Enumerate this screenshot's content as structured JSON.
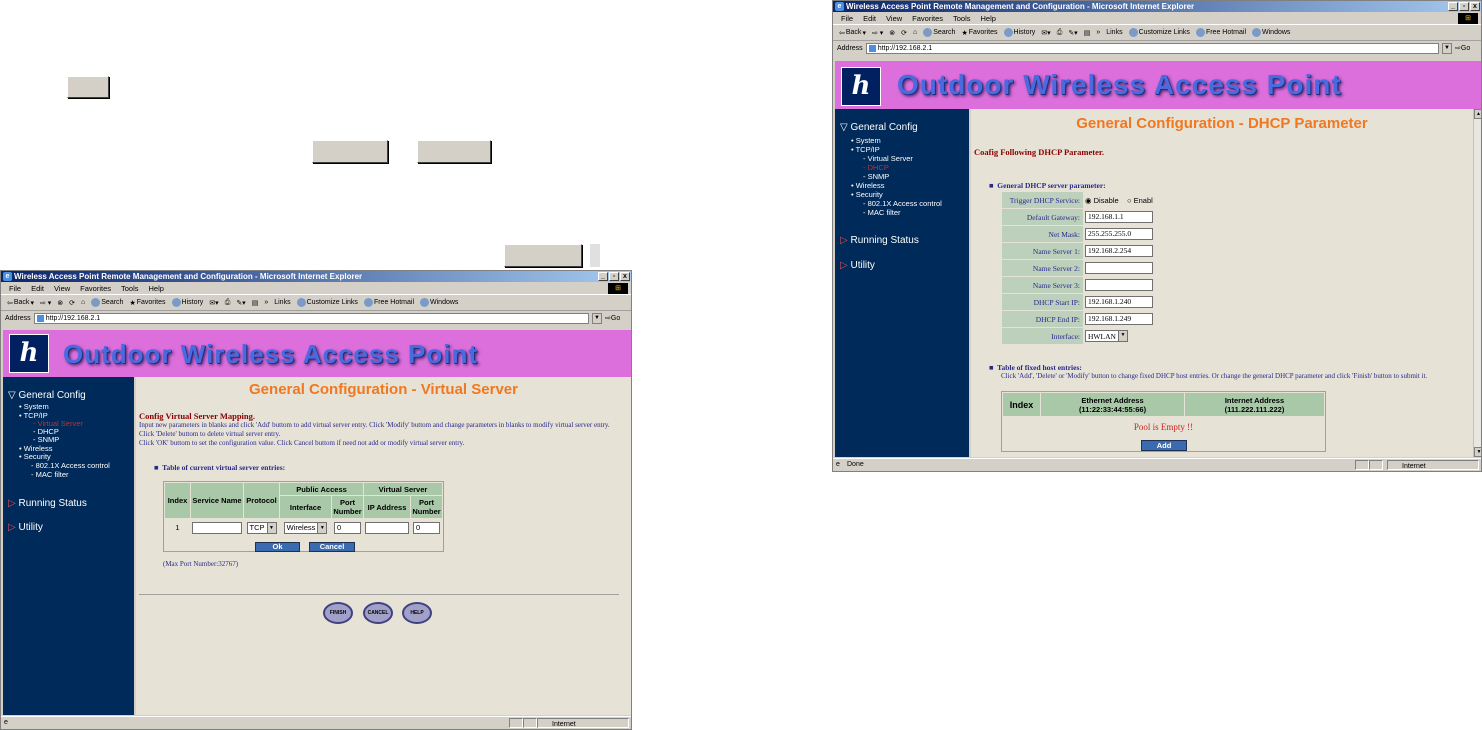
{
  "loose_buttons": {
    "a": "",
    "b": "",
    "c": "",
    "d": ""
  },
  "left_window": {
    "title": "Wireless Access Point Remote Management and Configuration - Microsoft Internet Explorer",
    "menu": [
      "File",
      "Edit",
      "View",
      "Favorites",
      "Tools",
      "Help"
    ],
    "toolbar": {
      "back": "Back",
      "search": "Search",
      "favorites": "Favorites",
      "history": "History",
      "links": "Links",
      "customize": "Customize Links",
      "hotmail": "Free Hotmail",
      "windows": "Windows"
    },
    "address_label": "Address",
    "address": "http://192.168.2.1",
    "go": "Go",
    "banner_title": "Outdoor Wireless Access Point",
    "sidebar": {
      "general": "General Config",
      "system": "System",
      "tcpip": "TCP/IP",
      "current": "Virtual Server",
      "dhcp": "DHCP",
      "snmp": "SNMP",
      "wireless": "Wireless",
      "security": "Security",
      "dot1x": "802.1X Access control",
      "mac": "MAC filter",
      "running": "Running Status",
      "utility": "Utility"
    },
    "page_title": "General Configuration - Virtual Server",
    "heading": "Config Virtual Server Mapping.",
    "instructions": "Input new parameters in blanks and click 'Add' buttom to add virtual server entry. Click 'Modify' buttom and change parameters in blanks to modify virtual server entry. Click 'Delete' buttom to delete virtual server entry.",
    "instructions2": "Click 'OK' buttom to set the configuration value. Click Cancel buttom if need not add or modify virtual server entry.",
    "table_caption": "Table of current virtual server entries:",
    "table": {
      "index": "Index",
      "service_name": "Service Name",
      "protocol": "Protocol",
      "public_access": "Public Access",
      "virtual_server": "Virtual Server",
      "interface": "Interface",
      "port_number": "Port Number",
      "ip_address": "IP Address",
      "row_index": "1",
      "protocol_value": "TCP",
      "interface_value": "Wireless",
      "public_port": "0",
      "virtual_port": "0"
    },
    "ok": "Ok",
    "cancel": "Cancel",
    "max_port": "(Max Port Number:32767)",
    "finish": "FINISH",
    "cancel_round": "CANCEL",
    "help": "HELP",
    "status_zone": "Internet"
  },
  "right_window": {
    "title": "Wireless Access Point Remote Management and Configuration - Microsoft Internet Explorer",
    "menu": [
      "File",
      "Edit",
      "View",
      "Favorites",
      "Tools",
      "Help"
    ],
    "toolbar": {
      "back": "Back",
      "search": "Search",
      "favorites": "Favorites",
      "history": "History",
      "links": "Links",
      "customize": "Customize Links",
      "hotmail": "Free Hotmail",
      "windows": "Windows"
    },
    "address_label": "Address",
    "address": "http://192.168.2.1",
    "go": "Go",
    "banner_title": "Outdoor Wireless Access Point",
    "sidebar": {
      "general": "General Config",
      "system": "System",
      "tcpip": "TCP/IP",
      "virtual": "Virtual Server",
      "current": "DHCP",
      "snmp": "SNMP",
      "wireless": "Wireless",
      "security": "Security",
      "dot1x": "802.1X Access control",
      "mac": "MAC filter",
      "running": "Running Status",
      "utility": "Utility"
    },
    "page_title": "General Configuration - DHCP Parameter",
    "heading": "Coafig Following DHCP Parameter.",
    "section1": "General DHCP server parameter:",
    "fields": {
      "trigger": "Trigger DHCP Service:",
      "disable": "Disable",
      "enable": "Enabl",
      "gateway_label": "Default Gateway:",
      "gateway": "192.168.1.1",
      "mask_label": "Net Mask:",
      "mask": "255.255.255.0",
      "ns1_label": "Name Server 1:",
      "ns1": "192.168.2.254",
      "ns2_label": "Name Server 2:",
      "ns2": "",
      "ns3_label": "Name Server 3:",
      "ns3": "",
      "start_label": "DHCP Start IP:",
      "start": "192.168.1.240",
      "end_label": "DHCP End IP:",
      "end": "192.168.1.249",
      "iface_label": "Interface:",
      "iface": "HWLAN"
    },
    "section2": "Table of fixed host entries:",
    "section2_desc": "Click 'Add', 'Delete' or 'Modify' button to change fixed DHCP host entries. Or change the general DHCP parameter and click 'Finish' button to submit it.",
    "host_table": {
      "index": "Index",
      "eth": "Ethernet Address",
      "eth_example": "(11:22:33:44:55:66)",
      "inet": "Internet Address",
      "inet_example": "(111.222.111.222)",
      "empty": "Pool is Empty !!"
    },
    "add": "Add",
    "status_done": "Done",
    "status_zone": "Internet"
  }
}
